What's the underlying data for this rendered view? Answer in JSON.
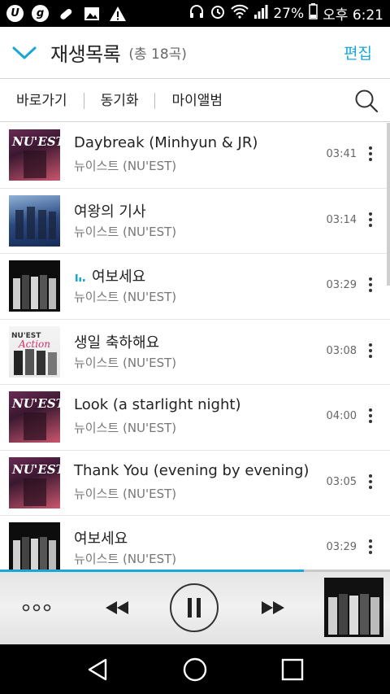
{
  "status_bar": {
    "battery": "27%",
    "time": "오후 6:21",
    "icons": [
      "u-plus-icon",
      "g-app-icon",
      "pill-icon",
      "image-icon",
      "warning-icon",
      "headphones-icon",
      "alarm-icon",
      "wifi-icon",
      "signal-icon",
      "battery-icon"
    ]
  },
  "header": {
    "title": "재생목록",
    "count": "(총 18곡)",
    "edit": "편집"
  },
  "menu": {
    "items": [
      "바로가기",
      "동기화",
      "마이앨범"
    ]
  },
  "songs": [
    {
      "title": "Daybreak (Minhyun & JR)",
      "artist": "뉴이스트 (NU'EST)",
      "duration": "03:41",
      "playing": false
    },
    {
      "title": "여왕의 기사",
      "artist": "뉴이스트 (NU'EST)",
      "duration": "03:14",
      "playing": false
    },
    {
      "title": "여보세요",
      "artist": "뉴이스트 (NU'EST)",
      "duration": "03:29",
      "playing": true
    },
    {
      "title": "생일 축하해요",
      "artist": "뉴이스트 (NU'EST)",
      "duration": "03:08",
      "playing": false
    },
    {
      "title": "Look (a starlight night)",
      "artist": "뉴이스트 (NU'EST)",
      "duration": "04:00",
      "playing": false
    },
    {
      "title": "Thank You (evening by evening)",
      "artist": "뉴이스트 (NU'EST)",
      "duration": "03:05",
      "playing": false
    },
    {
      "title": "여보세요",
      "artist": "뉴이스트 (NU'EST)",
      "duration": "03:29",
      "playing": false
    }
  ],
  "player": {
    "progress": 0.78
  },
  "colors": {
    "accent": "#1aa7d6"
  }
}
